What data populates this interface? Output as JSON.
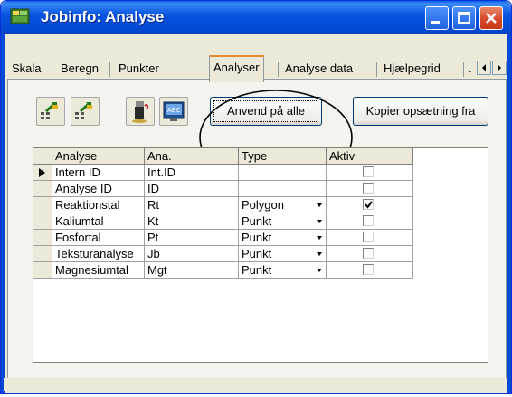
{
  "window": {
    "title": "Jobinfo: Analyse",
    "controls": {
      "minimize": "minimize",
      "maximize": "maximize",
      "close": "close"
    }
  },
  "tabs": [
    {
      "label": "Skala"
    },
    {
      "label": "Beregn"
    },
    {
      "label": "Punkter"
    },
    {
      "label": "Analyser",
      "active": true
    },
    {
      "label": "Analyse data"
    },
    {
      "label": "Hjælpegrid"
    },
    {
      "label": "."
    }
  ],
  "toolbar": {
    "icons": [
      "select-all-icon",
      "deselect-icon",
      "import-icon",
      "spellcheck-icon"
    ],
    "apply_label": "Anvend på alle",
    "copy_label": "Kopier opsætning fra"
  },
  "grid": {
    "columns": [
      "Analyse",
      "Ana.",
      "Type",
      "Aktiv"
    ],
    "rows": [
      {
        "analyse": "Intern ID",
        "abbr": "Int.ID",
        "type": "",
        "active": false,
        "current": true
      },
      {
        "analyse": "Analyse ID",
        "abbr": "ID",
        "type": "",
        "active": false
      },
      {
        "analyse": "Reaktionstal",
        "abbr": "Rt",
        "type": "Polygon",
        "active": true
      },
      {
        "analyse": "Kaliumtal",
        "abbr": "Kt",
        "type": "Punkt",
        "active": false
      },
      {
        "analyse": "Fosfortal",
        "abbr": "Pt",
        "type": "Punkt",
        "active": false
      },
      {
        "analyse": "Teksturanalyse",
        "abbr": "Jb",
        "type": "Punkt",
        "active": false
      },
      {
        "analyse": "Magnesiumtal",
        "abbr": "Mgt",
        "type": "Punkt",
        "active": false
      }
    ]
  },
  "colors": {
    "titlebar": "#0854e2",
    "face": "#ece9d8",
    "active_tab_accent": "#e68b2c"
  }
}
